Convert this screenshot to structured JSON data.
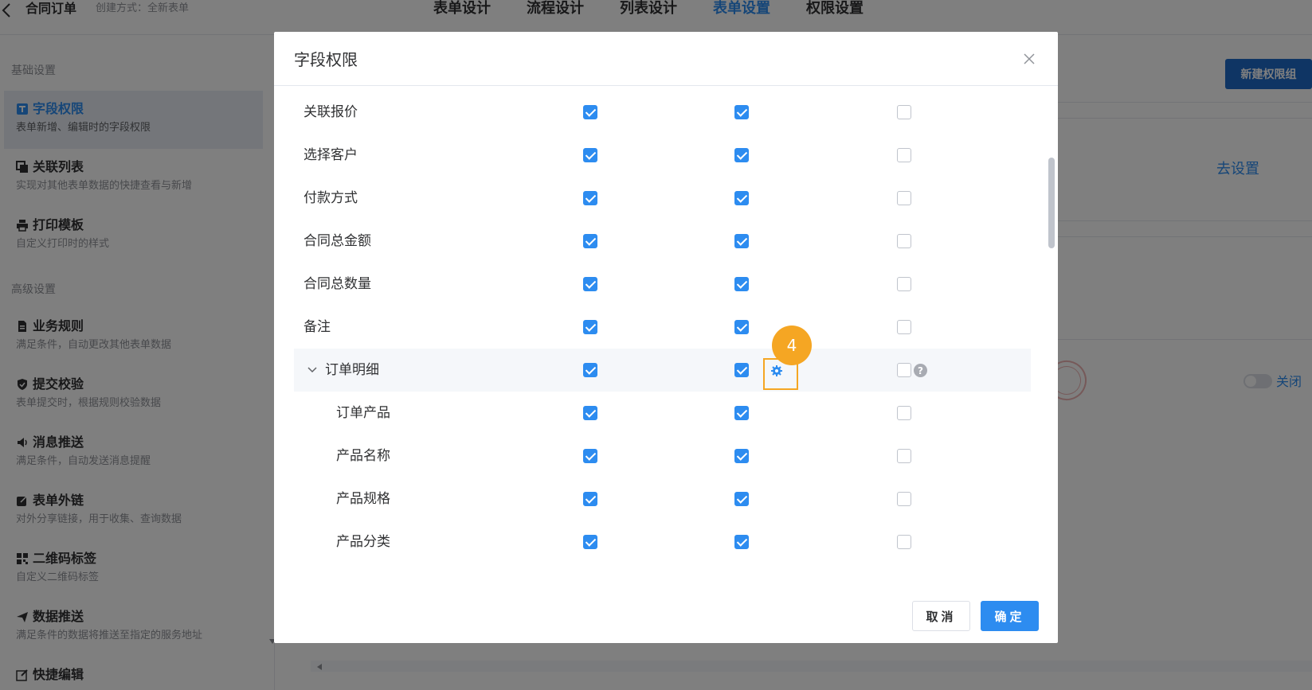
{
  "header": {
    "title": "合同订单",
    "create_mode": "创建方式：全新表单",
    "tabs": [
      {
        "label": "表单设计",
        "active": false
      },
      {
        "label": "流程设计",
        "active": false
      },
      {
        "label": "列表设计",
        "active": false
      },
      {
        "label": "表单设置",
        "active": true
      },
      {
        "label": "权限设置",
        "active": false
      }
    ]
  },
  "sidebar": {
    "section_basic": "基础设置",
    "section_advanced": "高级设置",
    "items": [
      {
        "label": "字段权限",
        "desc": "表单新增、编辑时的字段权限",
        "icon": "field-permission-icon",
        "active": true
      },
      {
        "label": "关联列表",
        "desc": "实现对其他表单数据的快捷查看与新增",
        "icon": "linked-list-icon"
      },
      {
        "label": "打印模板",
        "desc": "自定义打印时的样式",
        "icon": "printer-icon"
      },
      {
        "label": "业务规则",
        "desc": "满足条件，自动更改其他表单数据",
        "icon": "document-icon"
      },
      {
        "label": "提交校验",
        "desc": "表单提交时，根据规则校验数据",
        "icon": "shield-icon"
      },
      {
        "label": "消息推送",
        "desc": "满足条件，自动发送消息提醒",
        "icon": "speaker-icon"
      },
      {
        "label": "表单外链",
        "desc": "对外分享链接，用于收集、查询数据",
        "icon": "external-link-icon"
      },
      {
        "label": "二维码标签",
        "desc": "自定义二维码标签",
        "icon": "qrcode-icon"
      },
      {
        "label": "数据推送",
        "desc": "满足条件的数据将推送至指定的服务地址",
        "icon": "send-icon"
      },
      {
        "label": "快捷编辑",
        "desc": "",
        "icon": "edit-icon"
      }
    ]
  },
  "background": {
    "new_group_button": "新建权限组",
    "go_setting_link": "去设置",
    "toggle_label": "关闭"
  },
  "dialog": {
    "title": "字段权限",
    "rows": [
      {
        "name": "关联报价",
        "c1": true,
        "c2": true,
        "c3": false
      },
      {
        "name": "选择客户",
        "c1": true,
        "c2": true,
        "c3": false
      },
      {
        "name": "付款方式",
        "c1": true,
        "c2": true,
        "c3": false
      },
      {
        "name": "合同总金额",
        "c1": true,
        "c2": true,
        "c3": false
      },
      {
        "name": "合同总数量",
        "c1": true,
        "c2": true,
        "c3": false
      },
      {
        "name": "备注",
        "c1": true,
        "c2": true,
        "c3": false
      },
      {
        "name": "订单明细",
        "c1": true,
        "c2": true,
        "c3": false,
        "group": true
      },
      {
        "name": "订单产品",
        "c1": true,
        "c2": true,
        "c3": false,
        "child": true
      },
      {
        "name": "产品名称",
        "c1": true,
        "c2": true,
        "c3": false,
        "child": true
      },
      {
        "name": "产品规格",
        "c1": true,
        "c2": true,
        "c3": false,
        "child": true
      },
      {
        "name": "产品分类",
        "c1": true,
        "c2": true,
        "c3": false,
        "child": true
      }
    ],
    "step_badge": "4",
    "help_mark": "?",
    "cancel_label": "取消",
    "ok_label": "确定"
  },
  "colors": {
    "accent": "#2d8cf0",
    "highlight": "#f5a623",
    "overlay": "rgba(0,0,0,0.5)"
  }
}
